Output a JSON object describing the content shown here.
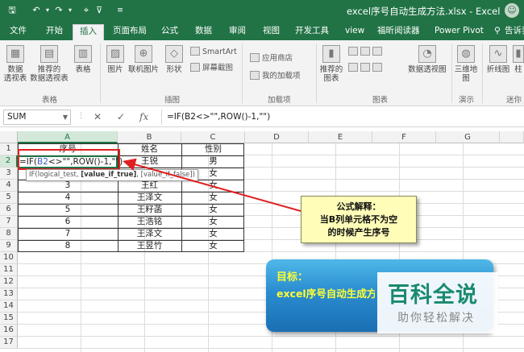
{
  "title_bar": {
    "doc_title": "excel序号自动生成方法.xlsx  -  Excel"
  },
  "tabs": [
    "文件",
    "开始",
    "插入",
    "页面布局",
    "公式",
    "数据",
    "审阅",
    "视图",
    "开发工具",
    "view",
    "福昕阅读器",
    "Power Pivot",
    "告诉我"
  ],
  "active_tab": "插入",
  "ribbon": {
    "pivot": "数据\n透视表",
    "rec_pivot": "推荐的\n数据透视表",
    "table": "表格",
    "group_tables": "表格",
    "picture": "图片",
    "online_pic": "联机图片",
    "shapes": "形状",
    "smartart": "SmartArt",
    "screenshot": "屏幕截图",
    "group_illus": "插图",
    "store": "应用商店",
    "my_addins": "我的加载项",
    "group_addins": "加载项",
    "rec_charts": "推荐的\n图表",
    "pivot_chart": "数据透视图",
    "group_charts": "图表",
    "map3d": "三维地\n图",
    "group_tours": "演示",
    "line": "折线图",
    "column": "柱",
    "group_spark": "迷你"
  },
  "formula_bar": {
    "name_box": "SUM",
    "cancel": "✕",
    "enter": "✓",
    "fx": "fx",
    "formula": "=IF(B2<>\"\",ROW()-1,\"\")"
  },
  "columns": [
    "A",
    "B",
    "C",
    "D",
    "E",
    "F",
    "G"
  ],
  "rows": [
    "1",
    "2",
    "3",
    "4",
    "5",
    "6",
    "7",
    "8",
    "9",
    "10",
    "11",
    "12",
    "13",
    "14",
    "15",
    "16",
    "17"
  ],
  "table": {
    "headers": [
      "序号",
      "姓名",
      "性别"
    ],
    "rows": [
      [
        "",
        "王锐",
        "男"
      ],
      [
        "",
        "王",
        "女"
      ],
      [
        "3",
        "王红",
        "女"
      ],
      [
        "4",
        "王泽文",
        "女"
      ],
      [
        "5",
        "王籽菡",
        "女"
      ],
      [
        "6",
        "王浩铭",
        "女"
      ],
      [
        "7",
        "王泽文",
        "女"
      ],
      [
        "8",
        "王昱竹",
        "女"
      ]
    ]
  },
  "editing": {
    "prefix": "=IF(",
    "ref": "B2",
    "rest": "<>\"\",ROW()-1,\"\")"
  },
  "tooltip": {
    "part1": "IF(logical_test, ",
    "part2": "[value_if_true]",
    "part3": ", [value_if_false])"
  },
  "callout": {
    "line1": "公式解释：",
    "line2": "当B列单元格不为空",
    "line3": "的时候产生序号"
  },
  "target": {
    "title": "目标：",
    "subtitle": "excel序号自动生成方法"
  },
  "watermark": {
    "main": "百科全说",
    "sub": "助你轻松解决"
  },
  "colors": {
    "excel_green": "#217346",
    "arrow_red": "#e02020",
    "callout_yellow": "#fffdb8",
    "target_blue": "#2a8ccf",
    "target_text": "#ffff33",
    "watermark_green": "#1a8a6e"
  }
}
